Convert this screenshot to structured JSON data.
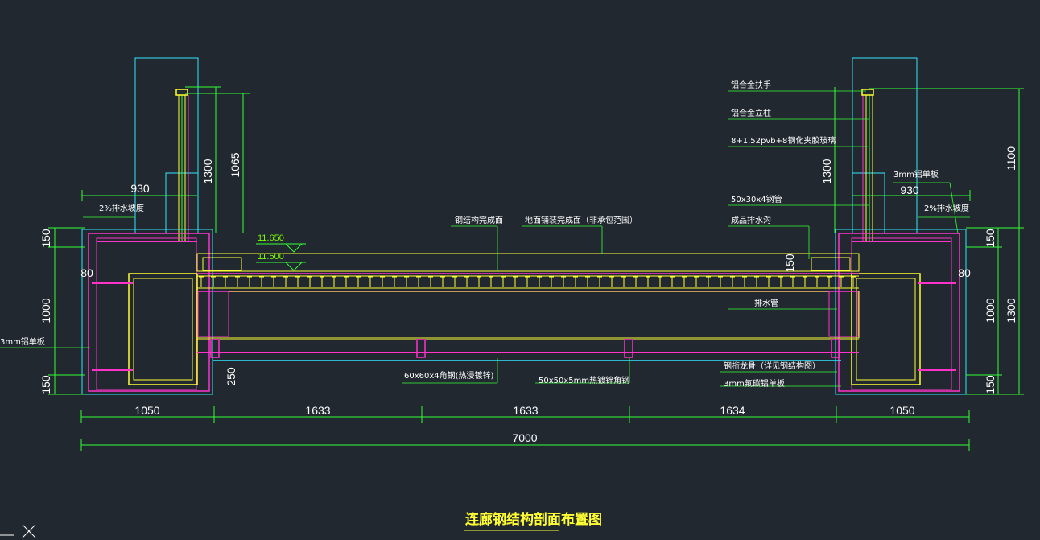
{
  "title": "连廊钢结构剖面布置图",
  "scale": "1:25",
  "colors": {
    "background": "#212830",
    "steel": "#ff33cc",
    "deck": "#ffff33",
    "dimension": "#33ff33",
    "outline": "#33e6ff",
    "text": "#ffffff"
  },
  "dimensions": {
    "bottom_segments": [
      "1050",
      "1633",
      "1633",
      "1634",
      "1050"
    ],
    "total": "7000",
    "left_height_parts": [
      "150",
      "1000",
      "150"
    ],
    "left_railing_height": "1300",
    "left_railing_inner": "1065",
    "left_railing_width": "930",
    "left_side_80": "80",
    "left_gap_250": "250",
    "right_height_parts": [
      "150",
      "1000",
      "150"
    ],
    "right_height_1300": "1300",
    "right_height_1100": "1100",
    "right_railing_height": "1300",
    "right_railing_width": "930",
    "right_side_80": "80",
    "right_150_deck": "150"
  },
  "elevations": [
    "11.650",
    "11.500"
  ],
  "annotations": {
    "left_slope": "2%排水坡度",
    "left_panel": "3mm铝单板",
    "right_slope": "2%排水坡度",
    "right_panel": "3mm铝单板",
    "railing_handrail": "铝合金扶手",
    "railing_post": "铝合金立柱",
    "glass": "8+1.52pvb+8钢化夹胶玻璃",
    "square_tube": "50x30x4钢管",
    "gutter": "成品排水沟",
    "finish_surface": "钢结构完成面",
    "floor_finish": "地面铺装完成面（非承包范围）",
    "drain_pipe": "排水管",
    "keel": "钢桁龙骨（详见钢结构图）",
    "ceiling_panel": "3mm氟碳铝单板",
    "angle_steel_60": "60x60x4角钢(热浸镀锌)",
    "angle_steel_50": "50x50x5mm热镀锌角钢"
  }
}
